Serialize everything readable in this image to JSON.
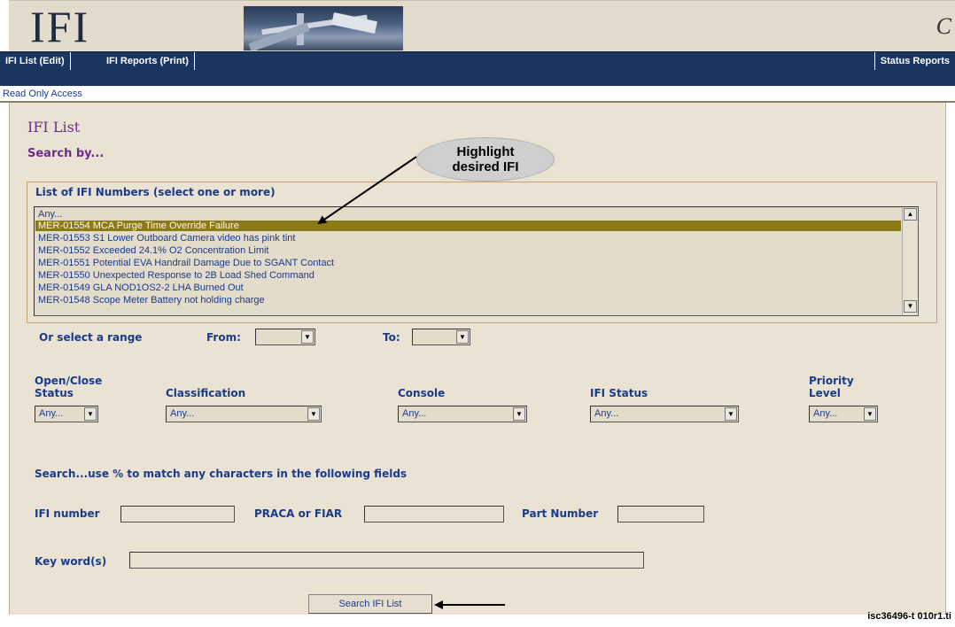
{
  "header": {
    "logo": "IFI",
    "corner_glyph": "C"
  },
  "nav": {
    "items": [
      "IFI List (Edit)",
      "IFI Reports (Print)"
    ],
    "right_item": "Status Reports"
  },
  "access_text": "Read Only Access",
  "page": {
    "title": "IFI List",
    "search_by": "Search by..."
  },
  "callout": {
    "line1": "Highlight",
    "line2": "desired IFI"
  },
  "ifi_list": {
    "label": "List of IFI Numbers (select one or more)",
    "items": [
      "Any...",
      "MER-01554 MCA Purge Time Override Failure",
      "MER-01553 S1 Lower Outboard Camera video has pink tint",
      "MER-01552 Exceeded 24.1% O2 Concentration Limit",
      "MER-01551 Potential EVA Handrail Damage Due to SGANT Contact",
      "MER-01550 Unexpected Response to 2B Load Shed Command",
      "MER-01549 GLA NOD1OS2-2 LHA Burned Out",
      "MER-01548 Scope Meter Battery not holding charge"
    ],
    "selected_index": 1
  },
  "range": {
    "label": "Or select a range",
    "from_label": "From:",
    "to_label": "To:",
    "from_value": "",
    "to_value": ""
  },
  "filters": {
    "open_close": {
      "label1": "Open/Close",
      "label2": "Status",
      "value": "Any..."
    },
    "classification": {
      "label": "Classification",
      "value": "Any..."
    },
    "console": {
      "label": "Console",
      "value": "Any..."
    },
    "ifi_status": {
      "label": "IFI Status",
      "value": "Any..."
    },
    "priority": {
      "label1": "Priority",
      "label2": "Level",
      "value": "Any..."
    }
  },
  "text_search": {
    "heading": "Search...use % to match any characters in the following fields",
    "ifi_number_label": "IFI number",
    "praca_label": "PRACA or FIAR",
    "part_number_label": "Part Number",
    "keywords_label": "Key word(s)"
  },
  "search_button": "Search IFI List",
  "figure_id": "isc36496-t 010r1.ti",
  "colors": {
    "nav_bg": "#1a3560",
    "panel_bg": "#eae3d3",
    "selected_row": "#8b7a16",
    "title_purple": "#6a2d8f",
    "label_blue": "#1a3a8a"
  }
}
